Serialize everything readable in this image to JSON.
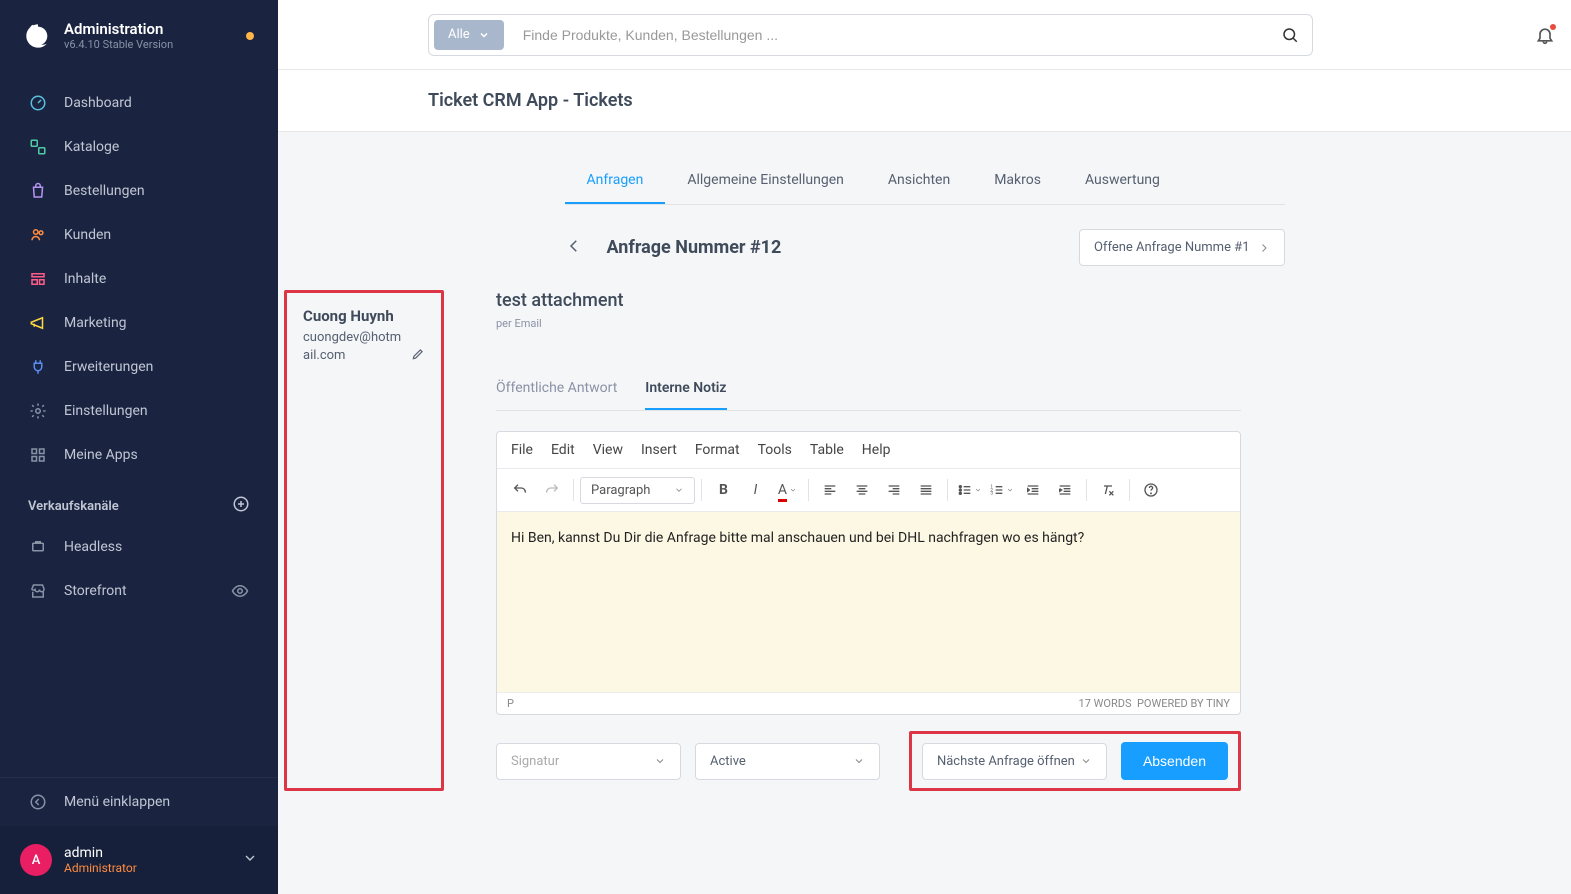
{
  "sidebar": {
    "title": "Administration",
    "version": "v6.4.10 Stable Version",
    "nav": [
      {
        "label": "Dashboard",
        "icon": "gauge"
      },
      {
        "label": "Kataloge",
        "icon": "catalog"
      },
      {
        "label": "Bestellungen",
        "icon": "bag"
      },
      {
        "label": "Kunden",
        "icon": "users"
      },
      {
        "label": "Inhalte",
        "icon": "content"
      },
      {
        "label": "Marketing",
        "icon": "megaphone"
      },
      {
        "label": "Erweiterungen",
        "icon": "plug"
      },
      {
        "label": "Einstellungen",
        "icon": "gear"
      },
      {
        "label": "Meine Apps",
        "icon": "grid"
      }
    ],
    "section_title": "Verkaufskanäle",
    "channels": [
      {
        "label": "Headless",
        "icon": "headless"
      },
      {
        "label": "Storefront",
        "icon": "storefront",
        "eye": true
      }
    ],
    "collapse": "Menü einklappen",
    "user": {
      "initial": "A",
      "name": "admin",
      "role": "Administrator"
    }
  },
  "topbar": {
    "filter": "Alle",
    "placeholder": "Finde Produkte, Kunden, Bestellungen ..."
  },
  "breadcrumb": "Ticket CRM App - Tickets",
  "tabs": [
    "Anfragen",
    "Allgemeine Einstellungen",
    "Ansichten",
    "Makros",
    "Auswertung"
  ],
  "page": {
    "title": "Anfrage Nummer #12",
    "next": "Offene Anfrage Numme #1"
  },
  "customer": {
    "name": "Cuong Huynh",
    "email": "cuongdev@hotmail.com"
  },
  "ticket": {
    "subject": "test attachment",
    "channel": "per Email"
  },
  "reply_tabs": [
    "Öffentliche Antwort",
    "Interne Notiz"
  ],
  "editor": {
    "menu": [
      "File",
      "Edit",
      "View",
      "Insert",
      "Format",
      "Tools",
      "Table",
      "Help"
    ],
    "block": "Paragraph",
    "body": "Hi Ben, kannst Du Dir die Anfrage bitte mal anschauen und bei DHL nachfragen wo es hängt?",
    "path": "P",
    "words": "17 WORDS",
    "powered": "POWERED BY TINY"
  },
  "actions": {
    "signature": "Signatur",
    "status": "Active",
    "next_action": "Nächste Anfrage öffnen",
    "submit": "Absenden"
  }
}
